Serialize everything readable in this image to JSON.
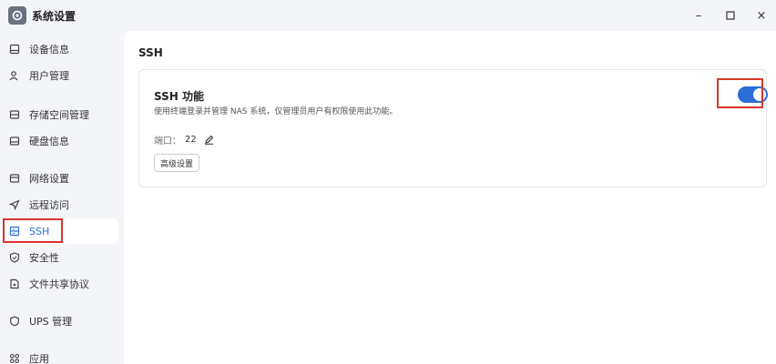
{
  "window": {
    "title": "系统设置",
    "minimize": "–",
    "maximize": "☐",
    "close": "×"
  },
  "sidebar": {
    "items": [
      {
        "label": "设备信息",
        "icon": "device-icon"
      },
      {
        "label": "用户管理",
        "icon": "users-icon"
      },
      {
        "label": "存储空间管理",
        "icon": "storage-icon"
      },
      {
        "label": "硬盘信息",
        "icon": "disk-icon"
      },
      {
        "label": "网络设置",
        "icon": "network-icon"
      },
      {
        "label": "远程访问",
        "icon": "remote-icon"
      },
      {
        "label": "SSH",
        "icon": "ssh-icon",
        "active": true
      },
      {
        "label": "安全性",
        "icon": "shield-icon"
      },
      {
        "label": "文件共享协议",
        "icon": "file-share-icon"
      },
      {
        "label": "UPS 管理",
        "icon": "ups-icon"
      },
      {
        "label": "应用",
        "icon": "apps-icon"
      }
    ]
  },
  "main": {
    "section_title": "SSH",
    "card": {
      "title": "SSH 功能",
      "description": "使用终端登录并管理 NAS 系统，仅管理员用户有权限使用此功能。",
      "port_label": "端口：",
      "port_value": "22",
      "advanced_button": "高级设置",
      "toggle_enabled": true
    }
  },
  "colors": {
    "accent": "#2a6ed6",
    "highlight_box": "#d9352c"
  }
}
